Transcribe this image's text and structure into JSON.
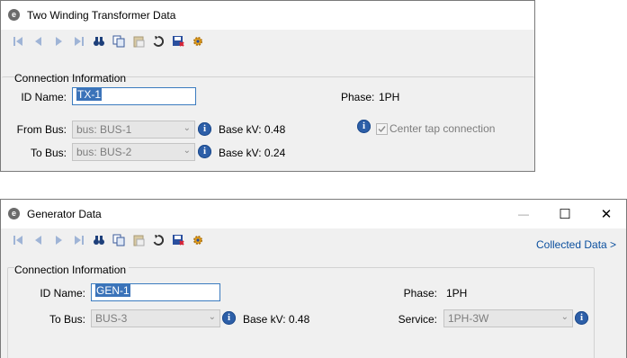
{
  "transformer_window": {
    "title": "Two Winding Transformer Data",
    "app_icon": "e",
    "toolbar": [
      "first-record-icon",
      "prev-record-icon",
      "next-record-icon",
      "last-record-icon",
      "binoculars-icon",
      "copy-icon",
      "paste-icon",
      "undo-icon",
      "save-icon",
      "settings-gear-icon"
    ],
    "section_title": "Connection Information",
    "id_name_label": "ID Name:",
    "id_name_value": "TX-1",
    "phase_label": "Phase:",
    "phase_value": "1PH",
    "from_bus_label": "From Bus:",
    "from_bus_value": "bus: BUS-1",
    "from_base_kv": "Base kV: 0.48",
    "to_bus_label": "To Bus:",
    "to_bus_value": "bus: BUS-2",
    "to_base_kv": "Base kV: 0.24",
    "center_tap_label": "Center tap connection",
    "center_tap_checked": true
  },
  "generator_window": {
    "title": "Generator Data",
    "app_icon": "e",
    "toolbar": [
      "first-record-icon",
      "prev-record-icon",
      "next-record-icon",
      "last-record-icon",
      "binoculars-icon",
      "copy-icon",
      "paste-icon",
      "undo-icon",
      "save-icon",
      "settings-gear-icon"
    ],
    "collected_data_link": "Collected Data >",
    "section_title": "Connection Information",
    "id_name_label": "ID Name:",
    "id_name_value": "GEN-1",
    "phase_label": "Phase:",
    "phase_value": "1PH",
    "to_bus_label": "To Bus:",
    "to_bus_value": "BUS-3",
    "base_kv": "Base kV: 0.48",
    "service_label": "Service:",
    "service_value": "1PH-3W",
    "controls": {
      "minimize": "—",
      "maximize": "☐",
      "close": "✕"
    }
  }
}
